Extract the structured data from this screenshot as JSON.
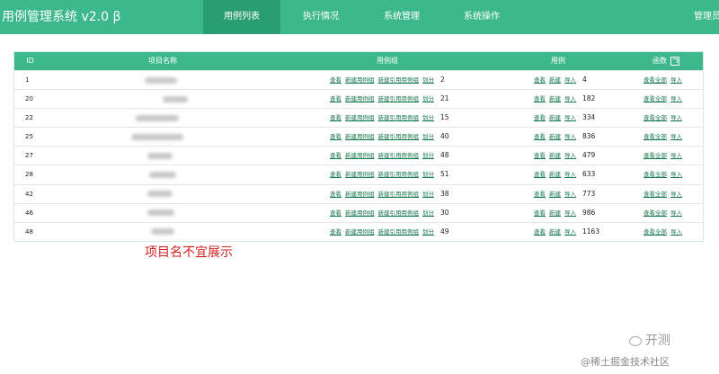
{
  "app_title": "用例管理系统 v2.0 β",
  "nav": {
    "items": [
      "用例列表",
      "执行情况",
      "系统管理",
      "系统操作"
    ],
    "active": "用例列表",
    "right": "管理员"
  },
  "table": {
    "headers": {
      "id": "ID",
      "name": "项目名称",
      "group": "用例组",
      "case": "用例",
      "func": "函数"
    },
    "group_links": [
      "查看",
      "新建用例组",
      "新建引用用例组",
      "划分"
    ],
    "case_links": [
      "查看",
      "新建",
      "导入"
    ],
    "func_links": [
      "查看全部",
      "导入"
    ],
    "rows": [
      {
        "id": "1",
        "groups": "2",
        "cases": "4"
      },
      {
        "id": "20",
        "groups": "21",
        "cases": "182"
      },
      {
        "id": "22",
        "groups": "15",
        "cases": "334"
      },
      {
        "id": "25",
        "groups": "40",
        "cases": "836"
      },
      {
        "id": "27",
        "groups": "48",
        "cases": "479"
      },
      {
        "id": "28",
        "groups": "51",
        "cases": "633"
      },
      {
        "id": "42",
        "groups": "38",
        "cases": "773"
      },
      {
        "id": "46",
        "groups": "30",
        "cases": "986"
      },
      {
        "id": "48",
        "groups": "49",
        "cases": "1163"
      }
    ]
  },
  "note": "项目名不宜展示",
  "watermark": {
    "line1": "开测",
    "line2": "@稀土掘金技术社区"
  }
}
